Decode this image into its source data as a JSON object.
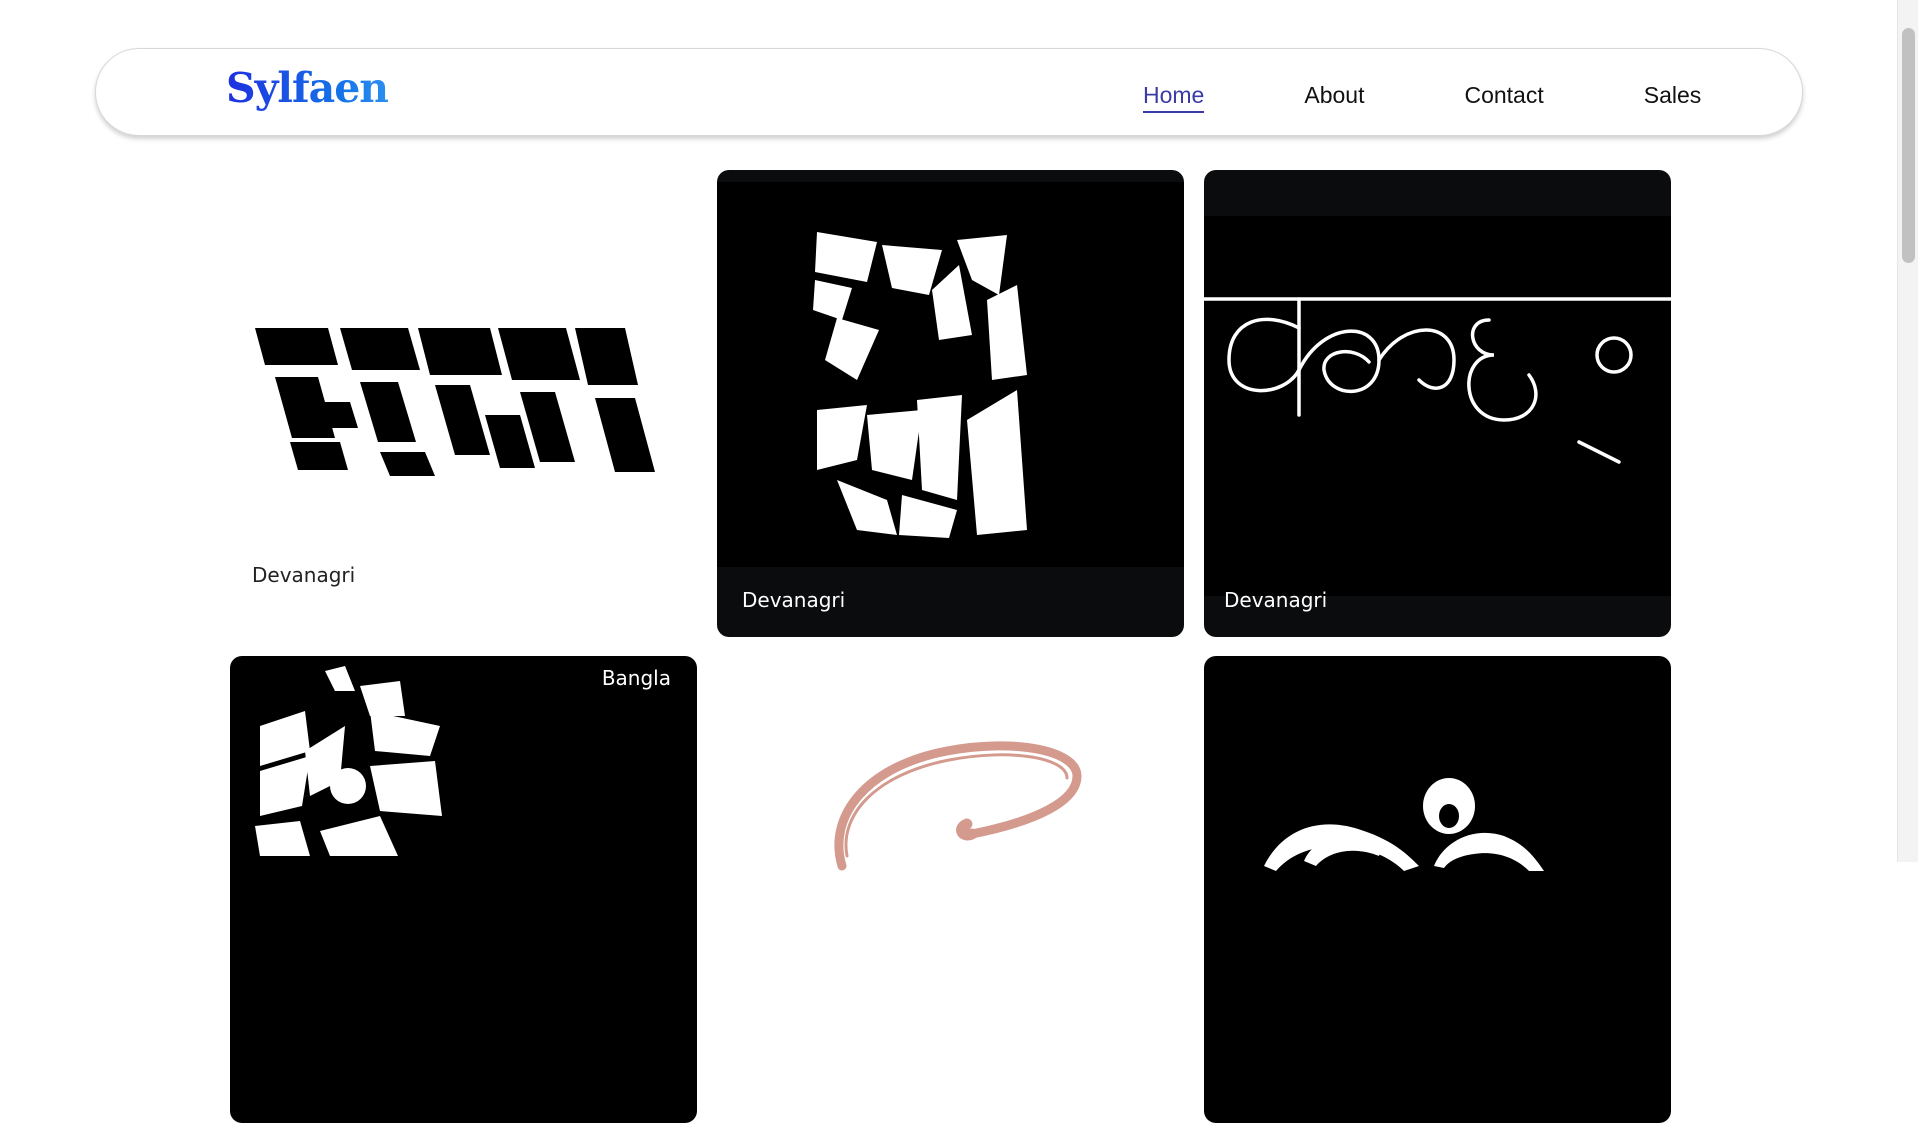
{
  "brand": {
    "logo_text": "Sylfaen"
  },
  "nav": {
    "items": [
      {
        "label": "Home",
        "active": true
      },
      {
        "label": "About",
        "active": false
      },
      {
        "label": "Contact",
        "active": false
      },
      {
        "label": "Sales",
        "active": false
      }
    ]
  },
  "gallery": {
    "cards": [
      {
        "label": "Devanagri",
        "theme": "light"
      },
      {
        "label": "Devanagri",
        "theme": "dark"
      },
      {
        "label": "Devanagri",
        "theme": "dark"
      },
      {
        "label": "Bangla",
        "theme": "dark"
      },
      {
        "label": "",
        "theme": "light"
      },
      {
        "label": "",
        "theme": "dark"
      }
    ]
  },
  "colors": {
    "logo_gradient_start": "#1e2fe0",
    "logo_gradient_end": "#2c8ff0",
    "nav_active": "#3b3ba6",
    "card_dark": "#0b0c0e",
    "stroke_accent": "#d49a8e"
  }
}
